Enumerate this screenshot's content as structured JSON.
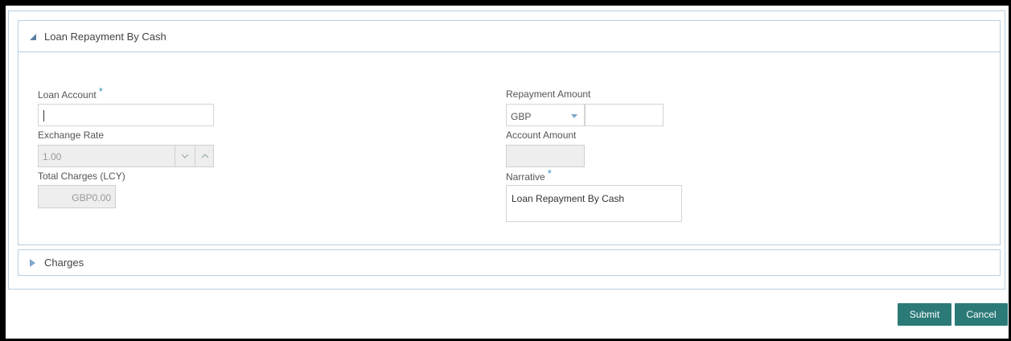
{
  "sections": {
    "main_title": "Loan Repayment By Cash",
    "charges_title": "Charges"
  },
  "fields": {
    "loan_account": {
      "label": "Loan Account",
      "required": "*",
      "value": ""
    },
    "exchange_rate": {
      "label": "Exchange Rate",
      "value": "1.00"
    },
    "total_charges": {
      "label": "Total Charges (LCY)",
      "value": "GBP0.00"
    },
    "repayment_amount": {
      "label": "Repayment Amount",
      "currency": "GBP",
      "value": ""
    },
    "account_amount": {
      "label": "Account Amount",
      "value": ""
    },
    "narrative": {
      "label": "Narrative",
      "required": "*",
      "value": "Loan Repayment By Cash"
    }
  },
  "buttons": {
    "submit": "Submit",
    "cancel": "Cancel"
  },
  "colors": {
    "accent": "#2b7a78",
    "border": "#b8cfe0",
    "required": "#3c8dbc"
  },
  "icons": {
    "expanded": "triangle-down-icon",
    "collapsed": "triangle-right-icon",
    "spin_down": "chevron-down-icon",
    "spin_up": "chevron-up-icon",
    "dropdown": "dropdown-arrow-icon"
  }
}
